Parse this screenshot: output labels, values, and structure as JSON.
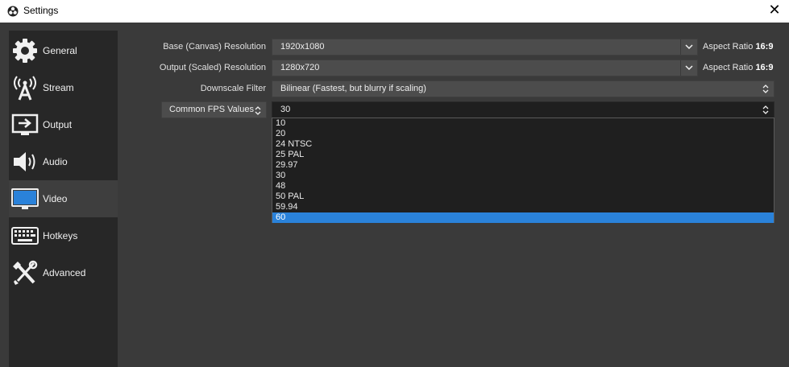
{
  "window": {
    "title": "Settings",
    "close_glyph": "✕"
  },
  "sidebar": {
    "items": [
      {
        "label": "General",
        "icon": "gear-icon"
      },
      {
        "label": "Stream",
        "icon": "antenna-icon"
      },
      {
        "label": "Output",
        "icon": "output-icon"
      },
      {
        "label": "Audio",
        "icon": "speaker-icon"
      },
      {
        "label": "Video",
        "icon": "monitor-icon",
        "active": true
      },
      {
        "label": "Hotkeys",
        "icon": "keyboard-icon"
      },
      {
        "label": "Advanced",
        "icon": "tools-icon"
      }
    ]
  },
  "video": {
    "base_label": "Base (Canvas) Resolution",
    "base_value": "1920x1080",
    "base_aspect_prefix": "Aspect Ratio",
    "base_aspect_value": "16:9",
    "output_label": "Output (Scaled) Resolution",
    "output_value": "1280x720",
    "output_aspect_prefix": "Aspect Ratio",
    "output_aspect_value": "16:9",
    "filter_label": "Downscale Filter",
    "filter_value": "Bilinear (Fastest, but blurry if scaling)",
    "fps_type": "Common FPS Values",
    "fps_value": "30",
    "fps_options": [
      "10",
      "20",
      "24 NTSC",
      "25 PAL",
      "29.97",
      "30",
      "48",
      "50 PAL",
      "59.94",
      "60"
    ],
    "fps_highlighted": "60"
  },
  "colors": {
    "accent": "#2a82da",
    "background": "#3a3a3a",
    "sidebar": "#272727"
  }
}
